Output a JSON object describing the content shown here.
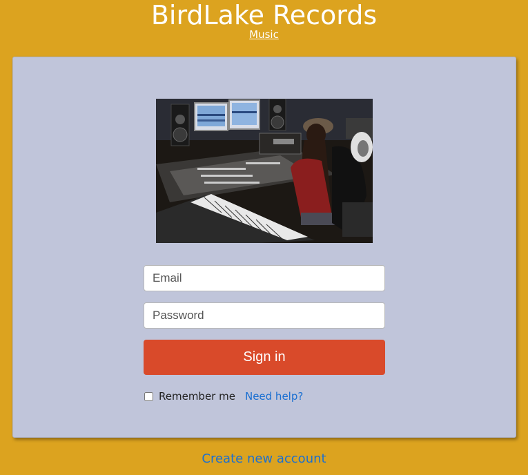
{
  "header": {
    "title": "BirdLake Records",
    "subtitle_link": "Music"
  },
  "login": {
    "email_placeholder": "Email",
    "password_placeholder": "Password",
    "signin_label": "Sign in",
    "remember_label": "Remember me",
    "remember_checked": false,
    "help_link": "Need help?"
  },
  "footer": {
    "create_account_link": "Create new account"
  },
  "colors": {
    "background": "#dca31f",
    "card": "#c0c5da",
    "primary_button": "#d94a2a",
    "link": "#1a6fd1"
  }
}
